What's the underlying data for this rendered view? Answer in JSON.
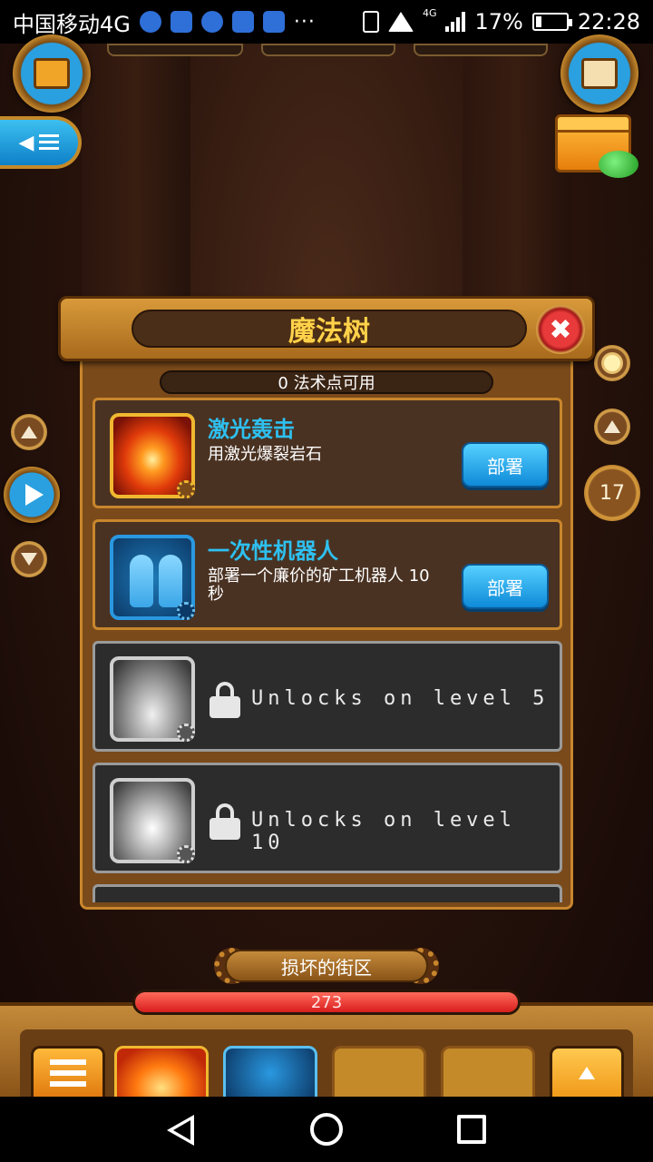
{
  "status_bar": {
    "carrier": "中国移动4G",
    "more": "···",
    "network": "4G",
    "battery": "17%",
    "time": "22:28"
  },
  "dialog": {
    "title": "魔法树",
    "close_label": "✖",
    "spell_points": "0 法术点可用"
  },
  "spells": [
    {
      "name": "激光轰击",
      "description": "用激光爆裂岩石",
      "button": "部署"
    },
    {
      "name": "一次性机器人",
      "description": "部署一个廉价的矿工机器人 10秒",
      "button": "部署"
    }
  ],
  "locked_spells": [
    {
      "text": "Unlocks on level 5"
    },
    {
      "text": "Unlocks on level 10"
    }
  ],
  "hud": {
    "level": "17",
    "zone_name": "损坏的街区",
    "hp_value": "273",
    "hp_fraction": 1.0
  }
}
